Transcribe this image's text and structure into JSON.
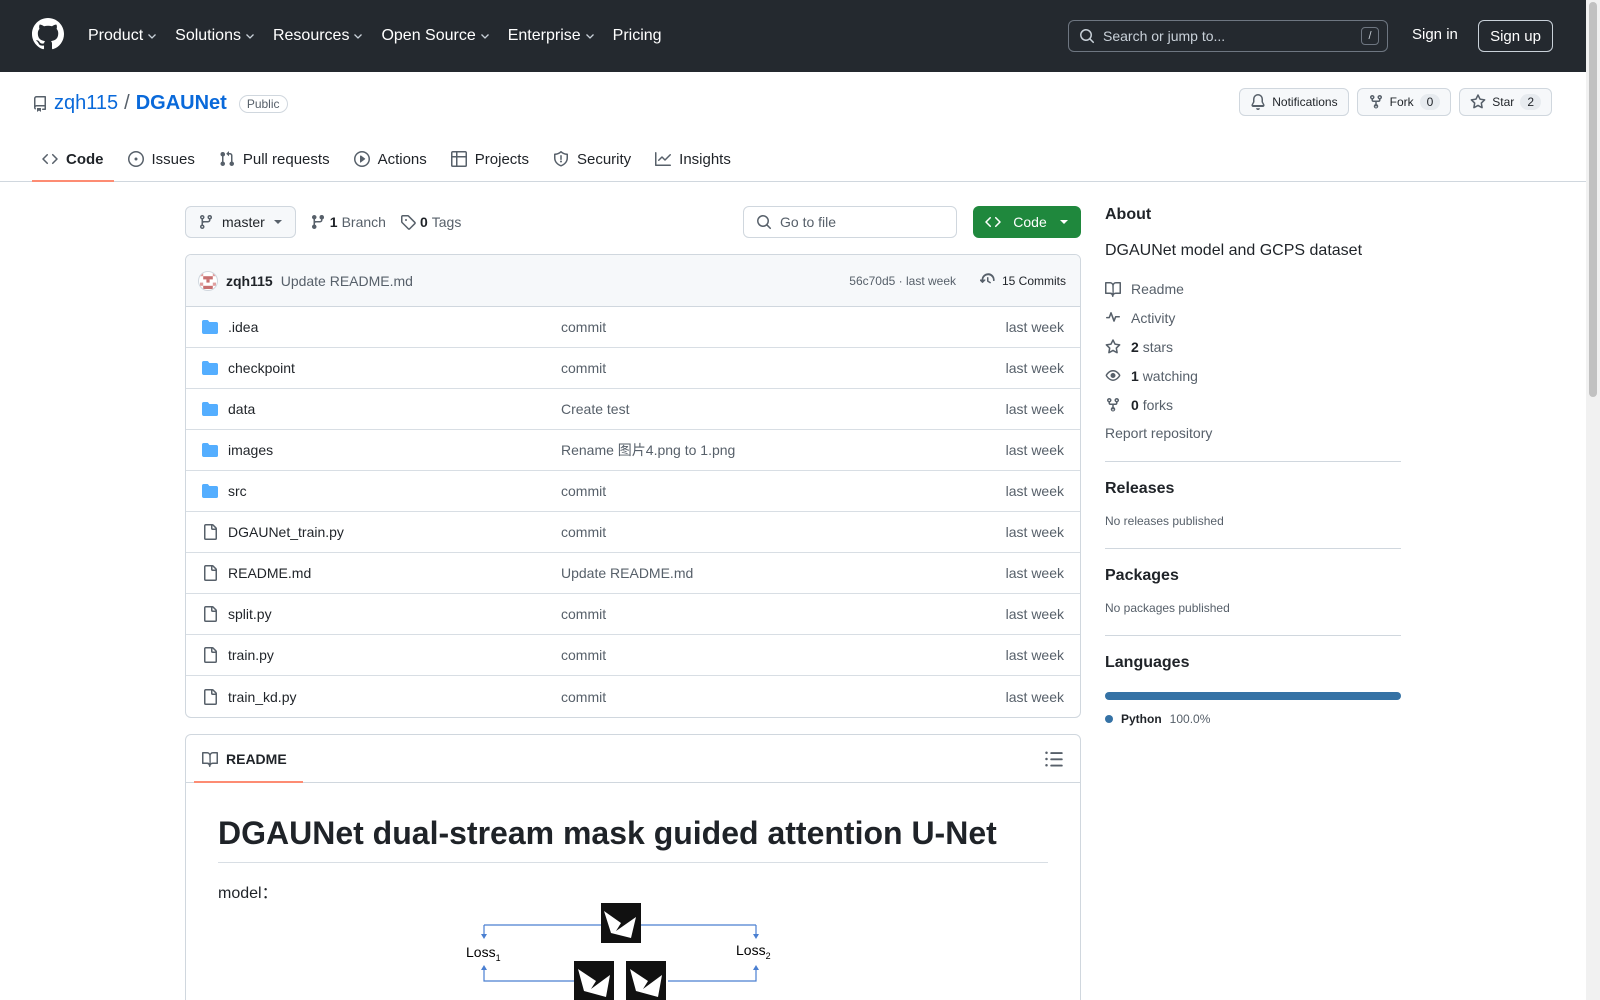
{
  "header": {
    "nav": [
      {
        "label": "Product",
        "has_menu": true
      },
      {
        "label": "Solutions",
        "has_menu": true
      },
      {
        "label": "Resources",
        "has_menu": true
      },
      {
        "label": "Open Source",
        "has_menu": true
      },
      {
        "label": "Enterprise",
        "has_menu": true
      },
      {
        "label": "Pricing",
        "has_menu": false
      }
    ],
    "search_placeholder": "Search or jump to...",
    "search_shortcut": "/",
    "sign_in": "Sign in",
    "sign_up": "Sign up"
  },
  "repo": {
    "owner": "zqh115",
    "separator": "/",
    "name": "DGAUNet",
    "visibility": "Public",
    "notifications_label": "Notifications",
    "fork_label": "Fork",
    "fork_count": "0",
    "star_label": "Star",
    "star_count": "2",
    "tabs": [
      {
        "label": "Code",
        "icon": "code-icon",
        "active": true
      },
      {
        "label": "Issues",
        "icon": "issue-icon",
        "active": false
      },
      {
        "label": "Pull requests",
        "icon": "pull-request-icon",
        "active": false
      },
      {
        "label": "Actions",
        "icon": "play-icon",
        "active": false
      },
      {
        "label": "Projects",
        "icon": "table-icon",
        "active": false
      },
      {
        "label": "Security",
        "icon": "shield-icon",
        "active": false
      },
      {
        "label": "Insights",
        "icon": "graph-icon",
        "active": false
      }
    ]
  },
  "toolbar": {
    "branch": "master",
    "branch_count": "1",
    "branch_label": "Branch",
    "tag_count": "0",
    "tag_label": "Tags",
    "goto_placeholder": "Go to file",
    "code_button": "Code"
  },
  "latest_commit": {
    "user": "zqh115",
    "message": "Update README.md",
    "meta": "56c70d5 · last week",
    "commits_label": "15 Commits"
  },
  "files": [
    {
      "name": ".idea",
      "type": "folder",
      "message": "commit",
      "date": "last week"
    },
    {
      "name": "checkpoint",
      "type": "folder",
      "message": "commit",
      "date": "last week"
    },
    {
      "name": "data",
      "type": "folder",
      "message": "Create test",
      "date": "last week"
    },
    {
      "name": "images",
      "type": "folder",
      "message": "Rename 图片4.png to 1.png",
      "date": "last week"
    },
    {
      "name": "src",
      "type": "folder",
      "message": "commit",
      "date": "last week"
    },
    {
      "name": "DGAUNet_train.py",
      "type": "file",
      "message": "commit",
      "date": "last week"
    },
    {
      "name": "README.md",
      "type": "file",
      "message": "Update README.md",
      "date": "last week"
    },
    {
      "name": "split.py",
      "type": "file",
      "message": "commit",
      "date": "last week"
    },
    {
      "name": "train.py",
      "type": "file",
      "message": "commit",
      "date": "last week"
    },
    {
      "name": "train_kd.py",
      "type": "file",
      "message": "commit",
      "date": "last week"
    }
  ],
  "readme": {
    "tab_label": "README",
    "heading": "DGAUNet dual-stream mask guided attention U-Net",
    "paragraph": "model：",
    "diagram_labels": {
      "loss1": "Loss",
      "loss1_sub": "1",
      "loss2": "Loss",
      "loss2_sub": "2"
    }
  },
  "sidebar": {
    "about_title": "About",
    "description": "DGAUNet model and GCPS dataset",
    "items": [
      {
        "icon": "book-icon",
        "count": "",
        "label": "Readme"
      },
      {
        "icon": "pulse-icon",
        "count": "",
        "label": "Activity"
      },
      {
        "icon": "star-icon",
        "count": "2",
        "label": "stars"
      },
      {
        "icon": "eye-icon",
        "count": "1",
        "label": "watching"
      },
      {
        "icon": "fork-icon",
        "count": "0",
        "label": "forks"
      }
    ],
    "report": "Report repository",
    "releases_title": "Releases",
    "releases_text": "No releases published",
    "packages_title": "Packages",
    "packages_text": "No packages published",
    "languages_title": "Languages",
    "language": {
      "name": "Python",
      "percent": "100.0%",
      "color": "#3572A5"
    }
  }
}
